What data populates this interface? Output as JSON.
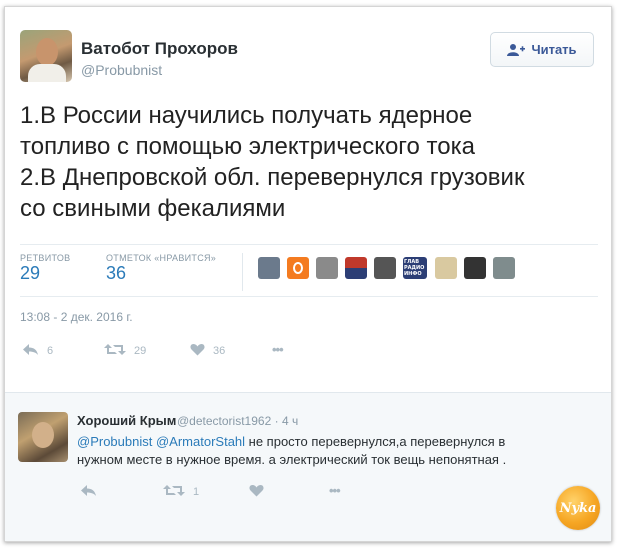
{
  "tweet": {
    "author_name": "Ватобот Прохоров",
    "author_handle": "@Probubnist",
    "follow_label": "Читать",
    "text_lines": [
      "1.В России научились получать ядерное",
      "топливо с помощью электрического тока",
      "2.В Днепровской обл. перевернулся грузовик",
      "со свиными фекалиями"
    ],
    "retweets_label": "РЕТВИТОВ",
    "retweets_count": "29",
    "likes_label": "ОТМЕТОК «НРАВИТСЯ»",
    "likes_count": "36",
    "timestamp": "13:08 - 2 дек. 2016 г.",
    "actions": {
      "reply_count": "6",
      "retweet_count": "29",
      "like_count": "36",
      "more_label": "•••"
    },
    "likers": [
      {
        "icon": "avatar-icon",
        "color": "#6b7a8c"
      },
      {
        "icon": "avatar-icon",
        "color": "#f47b20"
      },
      {
        "icon": "avatar-icon",
        "color": "#8a8a8a"
      },
      {
        "icon": "avatar-icon",
        "color": "#c0392b"
      },
      {
        "icon": "avatar-icon",
        "color": "#555555"
      },
      {
        "icon": "avatar-icon",
        "color": "#2c3e75"
      },
      {
        "icon": "avatar-icon",
        "color": "#d9c9a0"
      },
      {
        "icon": "avatar-icon",
        "color": "#333333"
      },
      {
        "icon": "avatar-icon",
        "color": "#7f8c8d"
      }
    ],
    "liker_badge_text": "ГЛАВ РАДИО ИНФО"
  },
  "reply": {
    "author_name": "Хороший Крым",
    "author_handle": "@detectorist1962",
    "time": "4 ч",
    "mentions": [
      "@Probubnist",
      "@ArmatorStahl"
    ],
    "text_part1": " не просто перевернулся,а перевернулся в",
    "text_part2": "нужном месте в нужное время. а электрический ток вещь непонятная .",
    "actions": {
      "retweet_count": "1",
      "more_label": "•••"
    }
  },
  "watermark": {
    "text": "Nyka"
  },
  "colors": {
    "link": "#2b7bb9",
    "muted": "#8899a6",
    "icon": "#aab8c2",
    "follow_text": "#3b5998"
  }
}
